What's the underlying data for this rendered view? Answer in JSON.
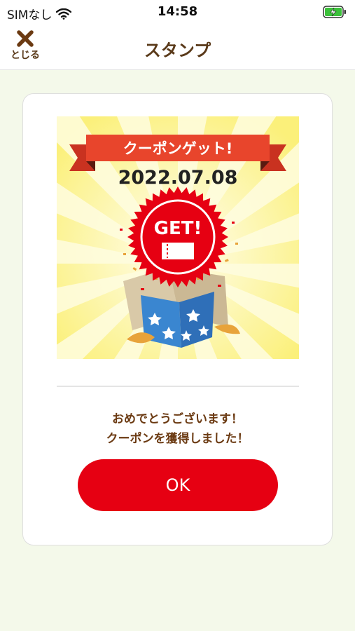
{
  "status_bar": {
    "carrier": "SIMなし",
    "time": "14:58",
    "battery_icon": "battery-charging-icon",
    "wifi_icon": "wifi-icon"
  },
  "nav": {
    "title": "スタンプ",
    "close_label": "とじる",
    "close_icon": "close-x-icon"
  },
  "coupon_image": {
    "banner_text": "クーポンゲット!",
    "date": "2022.07.08",
    "seal_text": "GET!",
    "colors": {
      "banner": "#e8452c",
      "seal": "#e60012",
      "background": "#fbf59a",
      "rays": "#fffde0"
    }
  },
  "message": {
    "line1": "おめでとうございます！",
    "line2": "クーポンを獲得しました！"
  },
  "ok_button": {
    "label": "OK",
    "color": "#e60012"
  }
}
